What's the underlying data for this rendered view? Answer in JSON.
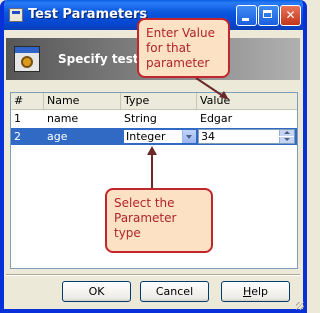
{
  "window": {
    "title": "Test Parameters"
  },
  "header": {
    "text": "Specify test p"
  },
  "table": {
    "columns": [
      "#",
      "Name",
      "Type",
      "Value"
    ],
    "rows": [
      {
        "index": "1",
        "name": "name",
        "type": "String",
        "value": "Edgar"
      },
      {
        "index": "2",
        "name": "age",
        "type": "Integer",
        "value": "34"
      }
    ]
  },
  "callouts": {
    "value": "Enter Value for that parameter",
    "type": "Select the Parameter type"
  },
  "buttons": {
    "ok": "OK",
    "cancel": "Cancel",
    "help_prefix": "",
    "help_underlined": "H",
    "help_suffix": "elp"
  },
  "colors": {
    "titlebar": "#0a5fe4",
    "selection": "#316ac5",
    "callout_fill": "#fde1c4",
    "callout_border": "#c2252c",
    "callout_text": "#b0242a"
  },
  "icons": {
    "window": "dialog-icon",
    "header": "parameters-gear-icon",
    "type_dropdown": "chevron-down-icon",
    "spinner": "spin-arrows-icon"
  }
}
